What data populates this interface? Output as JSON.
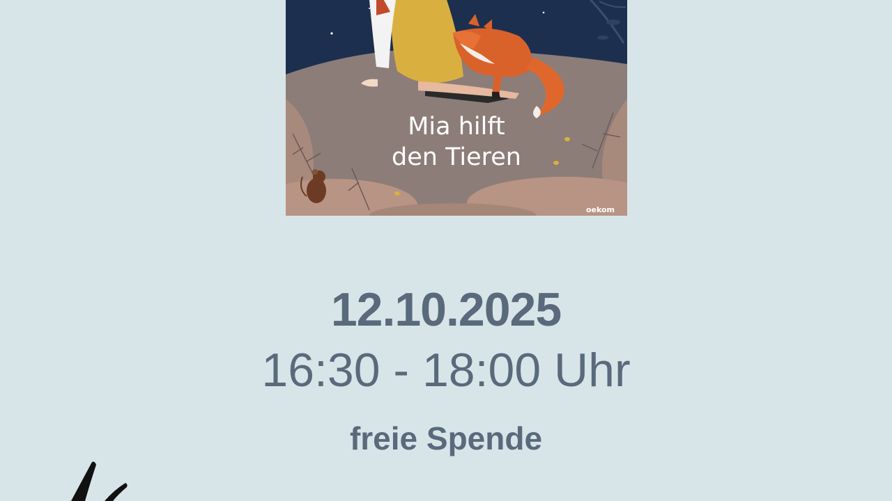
{
  "book": {
    "title_line1": "Mia hilft",
    "title_line2": "den Tieren",
    "publisher": "oekom"
  },
  "event": {
    "date": "12.10.2025",
    "time": "16:30 - 18:00 Uhr",
    "price": "freie Spende"
  },
  "colors": {
    "background": "#d8e5e8",
    "text": "#5a6a7c",
    "sky": "#1d2f4e",
    "ground": "#8c7d78",
    "fox": "#d9622b"
  }
}
